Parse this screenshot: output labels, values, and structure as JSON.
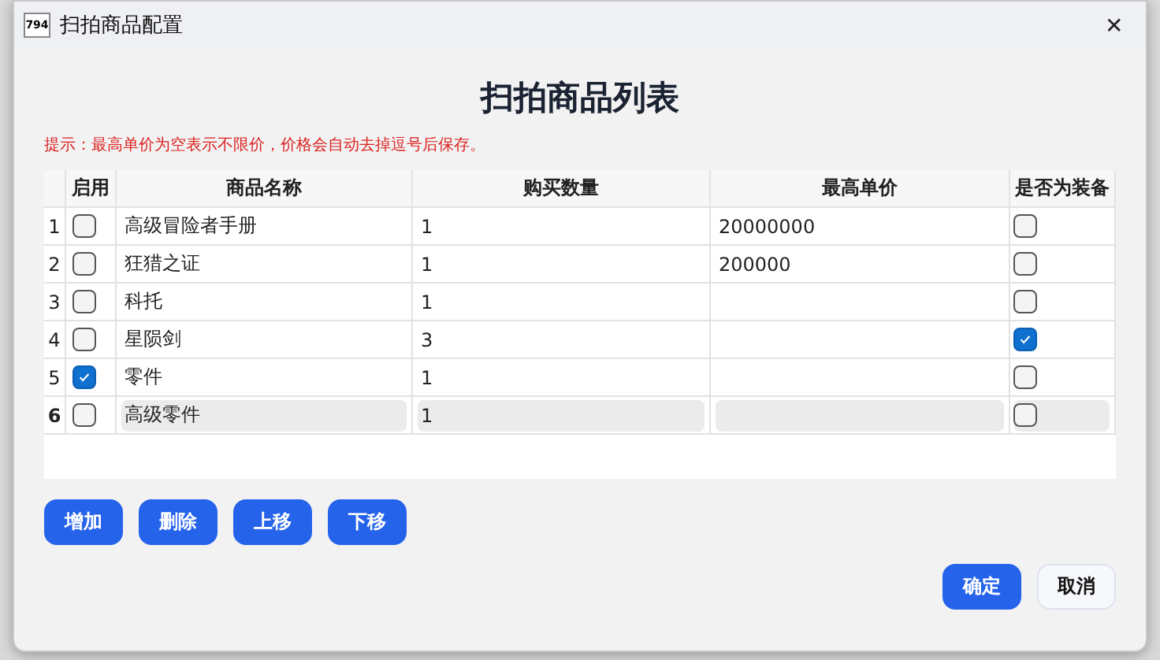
{
  "window": {
    "icon_text": "794",
    "title": "扫拍商品配置",
    "close": "✕"
  },
  "heading": "扫拍商品列表",
  "hint": "提示：最高单价为空表示不限价，价格会自动去掉逗号后保存。",
  "table": {
    "columns": [
      "启用",
      "商品名称",
      "购买数量",
      "最高单价",
      "是否为装备"
    ],
    "rows": [
      {
        "number": "1",
        "enabled": false,
        "name": "高级冒险者手册",
        "quantity": "1",
        "max_price": "20000000",
        "equipment": false,
        "selected": false
      },
      {
        "number": "2",
        "enabled": false,
        "name": "狂猎之证",
        "quantity": "1",
        "max_price": "200000",
        "equipment": false,
        "selected": false
      },
      {
        "number": "3",
        "enabled": false,
        "name": "科托",
        "quantity": "1",
        "max_price": "",
        "equipment": false,
        "selected": false
      },
      {
        "number": "4",
        "enabled": false,
        "name": "星陨剑",
        "quantity": "3",
        "max_price": "",
        "equipment": true,
        "selected": false
      },
      {
        "number": "5",
        "enabled": true,
        "name": "零件",
        "quantity": "1",
        "max_price": "",
        "equipment": false,
        "selected": false
      },
      {
        "number": "6",
        "enabled": false,
        "name": "高级零件",
        "quantity": "1",
        "max_price": "",
        "equipment": false,
        "selected": true
      }
    ]
  },
  "row_buttons": [
    "增加",
    "删除",
    "上移",
    "下移"
  ],
  "dialog_buttons": [
    {
      "label": "确定",
      "kind": "primary"
    },
    {
      "label": "取消",
      "kind": "secondary"
    }
  ]
}
